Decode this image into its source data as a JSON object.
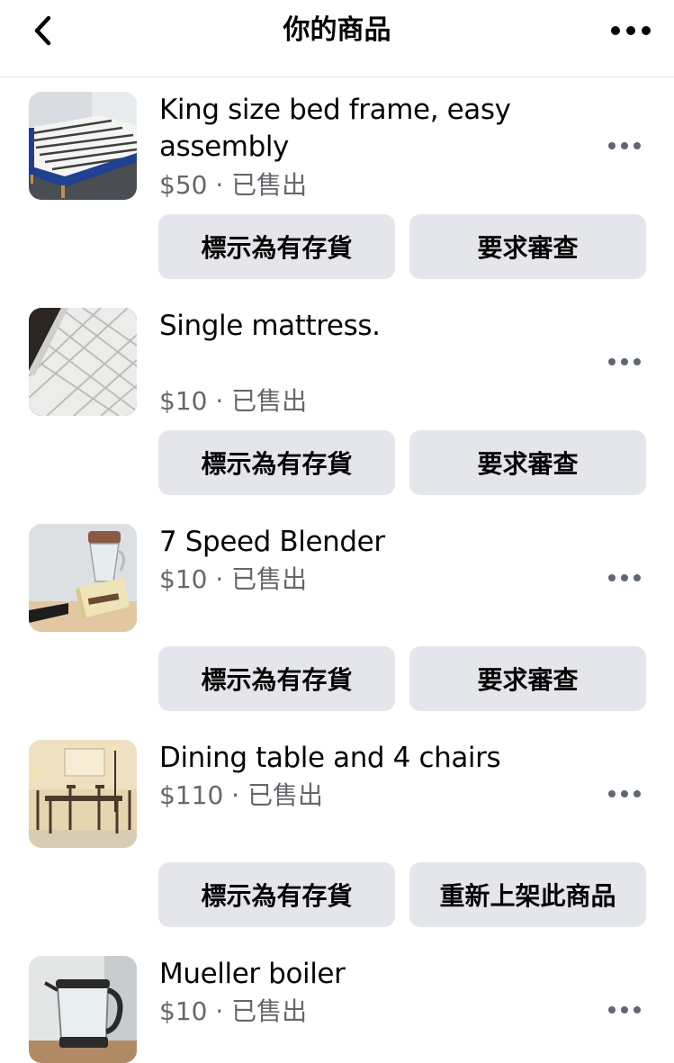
{
  "header": {
    "title": "你的商品",
    "back_icon": "chevron-left-icon",
    "more_icon": "more-horizontal-icon"
  },
  "items": [
    {
      "name": "King size bed frame, easy assembly",
      "price_status": "$50 · 已售出",
      "thumbnail": "bed-frame-photo",
      "primary_button": "標示為有存貨",
      "secondary_button": "要求審查"
    },
    {
      "name": "Single mattress.",
      "price_status": "$10 · 已售出",
      "thumbnail": "mattress-photo",
      "primary_button": "標示為有存貨",
      "secondary_button": "要求審查"
    },
    {
      "name": "7 Speed Blender",
      "price_status": "$10 · 已售出",
      "thumbnail": "blender-photo",
      "primary_button": "標示為有存貨",
      "secondary_button": "要求審查"
    },
    {
      "name": "Dining table and 4 chairs",
      "price_status": "$110 · 已售出",
      "thumbnail": "dining-table-photo",
      "primary_button": "標示為有存貨",
      "secondary_button": "重新上架此商品"
    },
    {
      "name": "Mueller boiler",
      "price_status": "$10 · 已售出",
      "thumbnail": "kettle-photo"
    }
  ],
  "colors": {
    "text_primary": "#050505",
    "text_secondary": "#65676b",
    "button_background": "#e4e6eb",
    "divider": "#e4e6eb"
  }
}
